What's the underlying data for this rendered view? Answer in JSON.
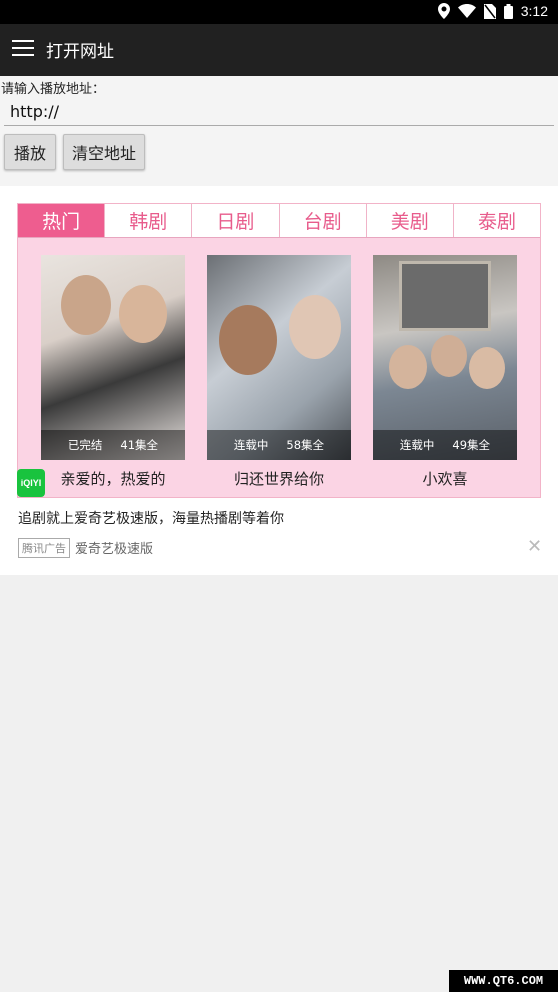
{
  "status_bar": {
    "time": "3:12",
    "icons": [
      "location-icon",
      "wifi-icon",
      "no-sim-icon",
      "battery-icon"
    ]
  },
  "app_bar": {
    "title": "打开网址",
    "menu_icon": "menu-icon"
  },
  "form": {
    "prompt": "请输入播放地址：",
    "url_value": "http://",
    "play_label": "播放",
    "clear_label": "清空地址"
  },
  "ad": {
    "tabs": [
      {
        "label": "热门",
        "active": true
      },
      {
        "label": "韩剧"
      },
      {
        "label": "日剧"
      },
      {
        "label": "台剧"
      },
      {
        "label": "美剧"
      },
      {
        "label": "泰剧"
      }
    ],
    "shows": [
      {
        "title": "亲爱的，热爱的",
        "status": "已完结",
        "episodes": "41集全"
      },
      {
        "title": "归还世界给你",
        "status": "连载中",
        "episodes": "58集全"
      },
      {
        "title": "小欢喜",
        "status": "连载中",
        "episodes": "49集全"
      }
    ],
    "logo_text": "iQIYI",
    "description": "追剧就上爱奇艺极速版，海量热播剧等着你",
    "tag": "腾讯广告",
    "source": "爱奇艺极速版",
    "close_symbol": "✕",
    "accent_color": "#ee5d8f"
  },
  "watermark": "WWW.QT6.COM"
}
